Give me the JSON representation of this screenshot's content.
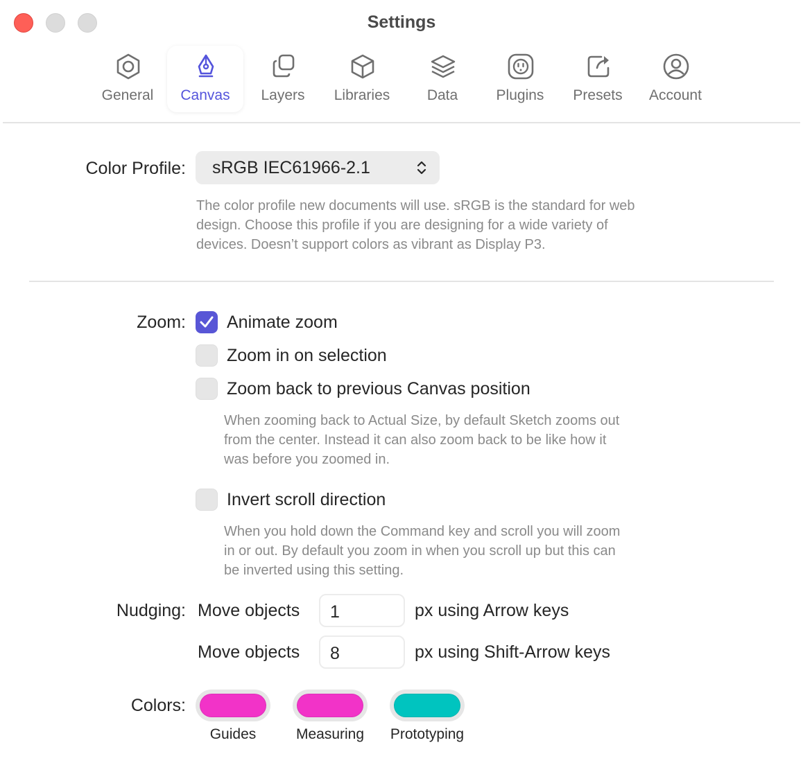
{
  "window": {
    "title": "Settings"
  },
  "tabs": [
    {
      "label": "General",
      "icon": "hexagon-gear-icon"
    },
    {
      "label": "Canvas",
      "icon": "pen-nib-icon",
      "active": true
    },
    {
      "label": "Layers",
      "icon": "layers-stack-icon"
    },
    {
      "label": "Libraries",
      "icon": "cube-icon"
    },
    {
      "label": "Data",
      "icon": "stack-icon"
    },
    {
      "label": "Plugins",
      "icon": "plug-icon"
    },
    {
      "label": "Presets",
      "icon": "share-icon"
    },
    {
      "label": "Account",
      "icon": "user-circle-icon"
    }
  ],
  "color_profile": {
    "label": "Color Profile:",
    "value": "sRGB IEC61966-2.1",
    "description_lines": [
      "The color profile new documents will use. sRGB is the standard for web",
      "design. Choose this profile if you are designing for a wide variety of",
      "devices. Doesn’t support colors as vibrant as Display P3."
    ]
  },
  "zoom": {
    "label": "Zoom:",
    "options": [
      {
        "label": "Animate zoom",
        "checked": true
      },
      {
        "label": "Zoom in on selection",
        "checked": false
      },
      {
        "label": "Zoom back to previous Canvas position",
        "checked": false
      },
      {
        "label": "Invert scroll direction",
        "checked": false
      }
    ],
    "zoom_back_desc_lines": [
      "When zooming back to Actual Size, by default Sketch zooms out",
      "from the center. Instead it can also zoom back to be like how it",
      "was before you zoomed in."
    ],
    "invert_desc_lines": [
      "When you hold down the Command key and scroll you will zoom",
      "in or out. By default you zoom in when you scroll up but this can",
      "be inverted using this setting."
    ]
  },
  "nudging": {
    "label": "Nudging:",
    "rows": [
      {
        "prefix": "Move objects",
        "value": "1",
        "suffix": "px using Arrow keys"
      },
      {
        "prefix": "Move objects",
        "value": "8",
        "suffix": "px using Shift-Arrow keys"
      }
    ]
  },
  "colors": {
    "label": "Colors:",
    "swatches": [
      {
        "label": "Guides",
        "color": "#f233c8"
      },
      {
        "label": "Measuring",
        "color": "#f233c8"
      },
      {
        "label": "Prototyping",
        "color": "#00c4bf"
      }
    ]
  },
  "accent_color": "#5856d6"
}
